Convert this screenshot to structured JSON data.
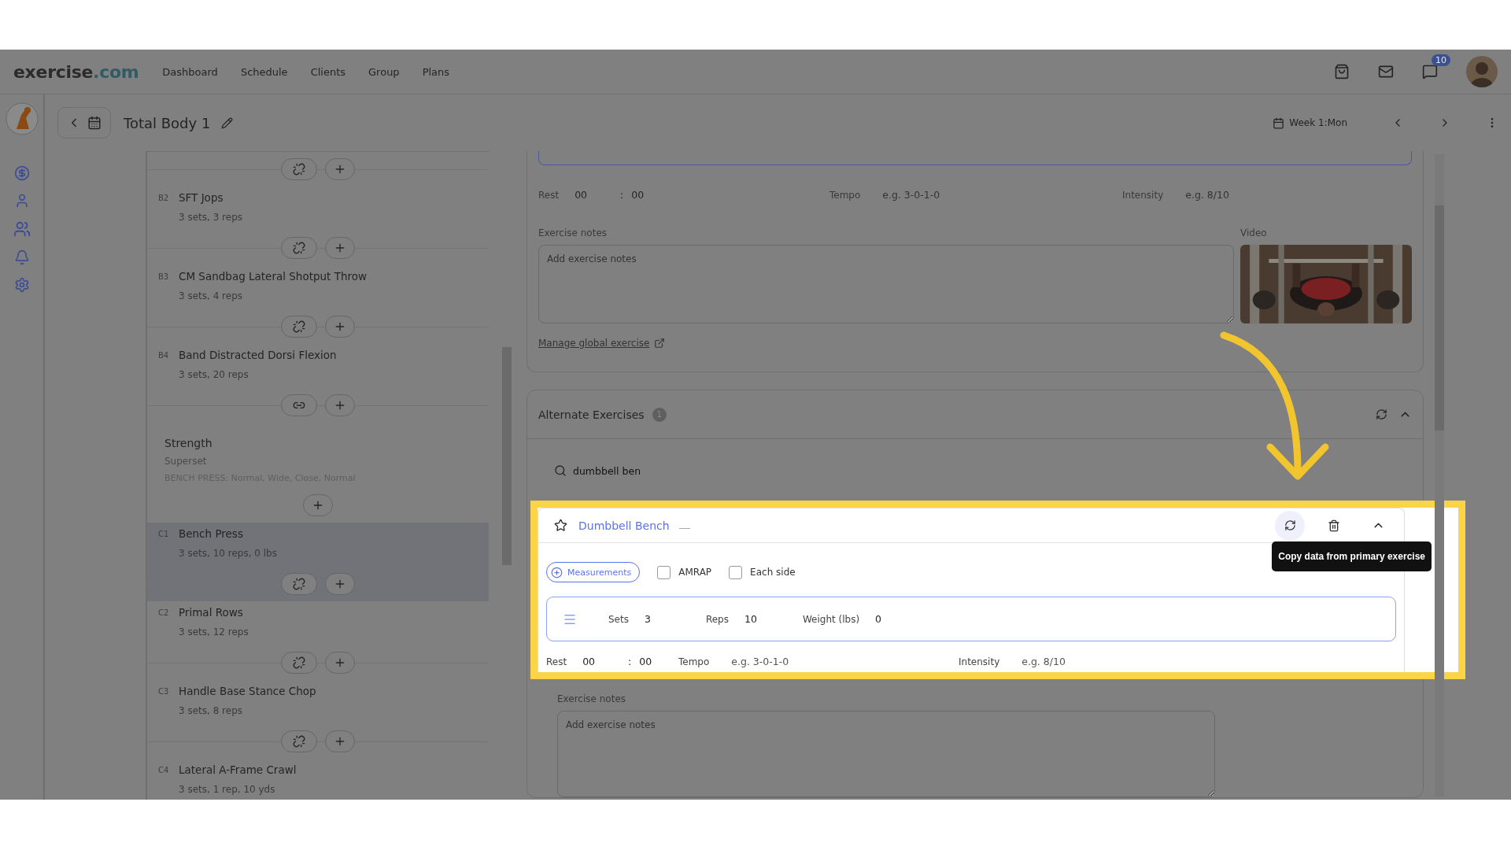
{
  "nav": {
    "logo_main": "exercise",
    "logo_accent": ".com",
    "items": [
      "Dashboard",
      "Schedule",
      "Clients",
      "Group",
      "Plans"
    ],
    "badge": "10"
  },
  "header": {
    "title": "Total Body 1",
    "week": "Week 1:Mon"
  },
  "list": [
    {
      "kind": "connector",
      "linked": false
    },
    {
      "kind": "exercise",
      "label": "B2",
      "name": "SFT Jops",
      "summary": "3 sets, 3 reps",
      "selected": false
    },
    {
      "kind": "connector",
      "linked": false
    },
    {
      "kind": "exercise",
      "label": "B3",
      "name": "CM Sandbag Lateral Shotput Throw",
      "summary": "3 sets, 4 reps",
      "selected": false
    },
    {
      "kind": "connector",
      "linked": false
    },
    {
      "kind": "exercise",
      "label": "B4",
      "name": "Band Distracted Dorsi Flexion",
      "summary": "3 sets, 20 reps",
      "selected": false
    },
    {
      "kind": "connector",
      "linked": true
    },
    {
      "kind": "group",
      "title": "Strength",
      "subtitle": "Superset",
      "detail": "BENCH PRESS: Normal, Wide, Close, Normal"
    },
    {
      "kind": "add"
    },
    {
      "kind": "exercise",
      "label": "C1",
      "name": "Bench Press",
      "summary": "3 sets, 10 reps, 0 lbs",
      "selected": true
    },
    {
      "kind": "connector",
      "linked": false
    },
    {
      "kind": "exercise",
      "label": "C2",
      "name": "Primal Rows",
      "summary": "3 sets, 12 reps",
      "selected": false
    },
    {
      "kind": "connector",
      "linked": false
    },
    {
      "kind": "exercise",
      "label": "C3",
      "name": "Handle Base Stance Chop",
      "summary": "3 sets, 8 reps",
      "selected": false
    },
    {
      "kind": "connector",
      "linked": false
    },
    {
      "kind": "exercise",
      "label": "C4",
      "name": "Lateral A-Frame Crawl",
      "summary": "3 sets, 1 rep, 10 yds",
      "selected": false
    }
  ],
  "primary": {
    "rest": {
      "label": "Rest",
      "minutes": "00",
      "separator": ":",
      "seconds": "00"
    },
    "tempo": {
      "label": "Tempo",
      "placeholder": "e.g. 3-0-1-0"
    },
    "intensity": {
      "label": "Intensity",
      "placeholder": "e.g. 8/10"
    },
    "notes": {
      "label": "Exercise notes",
      "placeholder": "Add exercise notes"
    },
    "video_label": "Video",
    "manage_link": "Manage global exercise"
  },
  "alternates": {
    "title": "Alternate Exercises",
    "count": "1",
    "expanded": true,
    "search": {
      "value": "dumbbell ben"
    },
    "items": [
      {
        "name": "Dumbbell Bench",
        "starred": false,
        "expanded": true,
        "measurements": "Measurements",
        "options": [
          {
            "label": "AMRAP",
            "checked": false
          },
          {
            "label": "Each side",
            "checked": false
          }
        ],
        "fields": [
          {
            "label": "Sets",
            "value": "3"
          },
          {
            "label": "Reps",
            "value": "10"
          },
          {
            "label": "Weight (lbs)",
            "value": "0"
          }
        ],
        "rest": {
          "label": "Rest",
          "minutes": "00",
          "separator": ":",
          "seconds": "00"
        },
        "tempo": {
          "label": "Tempo",
          "placeholder": "e.g. 3-0-1-0"
        },
        "intensity": {
          "label": "Intensity",
          "placeholder": "e.g. 8/10"
        },
        "notes": {
          "label": "Exercise notes",
          "placeholder": "Add exercise notes"
        },
        "tooltip": "Copy data from primary exercise"
      }
    ]
  }
}
